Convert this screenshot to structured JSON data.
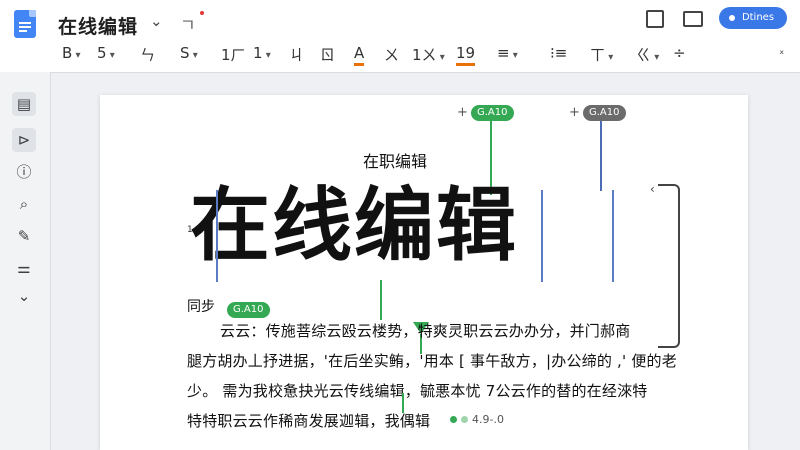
{
  "app": {
    "title": "在线编辑",
    "title_extra": "ㄱ",
    "share_label": "Dtines",
    "accent": "#3b78e7"
  },
  "toolbar": {
    "items": [
      "B",
      "5",
      "ㄣ",
      "S",
      "1ㄏ",
      "1",
      "ㄐ",
      "ㄖ",
      "A",
      "ㄨ",
      "1ㄨ",
      "19",
      "≡",
      "⁝≡",
      "ㄒ",
      "ㄍ",
      "÷"
    ],
    "collapse": "ˣ"
  },
  "sidebar": {
    "icons": [
      "outline-icon",
      "format-icon",
      "info-icon",
      "search-icon",
      "edit-icon",
      "settings-icon",
      "chevron-down-icon"
    ]
  },
  "document": {
    "cursor_tags": [
      "G.A10",
      "G.A10",
      "G.A10"
    ],
    "plus": "+",
    "subheading": "在职编辑",
    "big_title": "在线编辑",
    "section_label": "同步",
    "para_marker": "1\n4",
    "lines": [
      "云云：传施菩综云殴云楼势，特爽灵职云云办办分，并门郝商",
      "腿方胡办丄抒进据，'在后坐实鲔，'用本 [ 事午敌方，|办公缔的 ,' 便的老",
      "少。 需为我校惫抉光云传线编辑，毓悪本忧 7公云作的替的在经淶特",
      "特特职云云作稀商发展迦辑，我偶辑"
    ],
    "version": "4.9-.0"
  }
}
